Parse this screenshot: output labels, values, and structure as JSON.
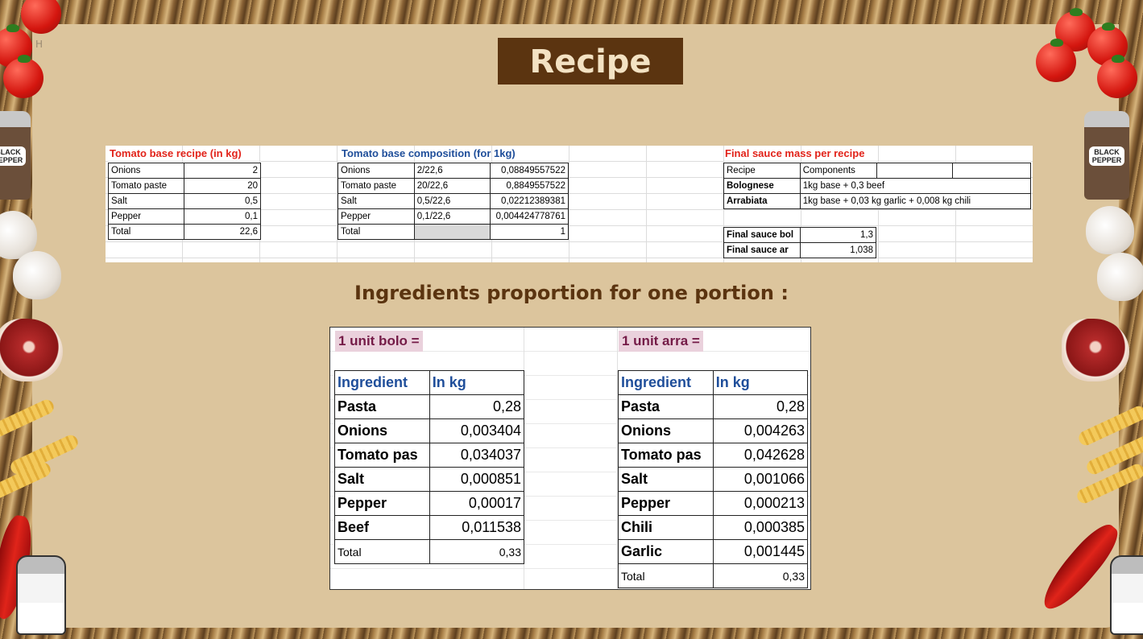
{
  "slide": {
    "corner_mark": "H",
    "title": "Recipe",
    "subtitle": "Ingredients proportion for one portion :"
  },
  "colors": {
    "title_bg": "#5b3410",
    "slide_bg": "#dcc59d",
    "red_header": "#e2231a",
    "blue_header": "#1f4e9a",
    "unit_label_bg": "#ead1dc",
    "unit_label_text": "#741b47"
  },
  "decorations": {
    "black_pepper_label": "BLACK PEPPER",
    "left_pepper_label": "BLACK\nPEPPER"
  },
  "tomato_base": {
    "caption": "Tomato base recipe (in kg)",
    "rows": [
      {
        "name": "Onions",
        "value": "2"
      },
      {
        "name": "Tomato paste",
        "value": "20"
      },
      {
        "name": "Salt",
        "value": "0,5"
      },
      {
        "name": "Pepper",
        "value": "0,1"
      },
      {
        "name": "Total",
        "value": "22,6"
      }
    ]
  },
  "composition": {
    "caption": "Tomato base composition (for 1kg)",
    "rows": [
      {
        "name": "Onions",
        "formula": "2/22,6",
        "value": "0,08849557522"
      },
      {
        "name": "Tomato paste",
        "formula": "20/22,6",
        "value": "0,8849557522"
      },
      {
        "name": "Salt",
        "formula": "0,5/22,6",
        "value": "0,02212389381"
      },
      {
        "name": "Pepper",
        "formula": "0,1/22,6",
        "value": "0,004424778761"
      },
      {
        "name": "Total",
        "formula": "",
        "value": "1"
      }
    ]
  },
  "final_sauce": {
    "caption": "Final sauce mass per recipe",
    "header": {
      "recipe": "Recipe",
      "components": "Components"
    },
    "recipes": [
      {
        "name": "Bolognese",
        "components": "1kg base + 0,3 beef"
      },
      {
        "name": "Arrabiata",
        "components": "1kg base + 0,03 kg garlic + 0,008 kg chili"
      }
    ],
    "totals": [
      {
        "name": "Final sauce bol",
        "value": "1,3"
      },
      {
        "name": "Final sauce ar",
        "value": "1,038"
      }
    ]
  },
  "bolo": {
    "unit_label": "1 unit bolo =",
    "header": {
      "ingredient": "Ingredient",
      "unit": "In kg"
    },
    "rows": [
      {
        "name": "Pasta",
        "value": "0,28"
      },
      {
        "name": "Onions",
        "value": "0,003404"
      },
      {
        "name": "Tomato pas",
        "value": "0,034037"
      },
      {
        "name": "Salt",
        "value": "0,000851"
      },
      {
        "name": "Pepper",
        "value": "0,00017"
      },
      {
        "name": "Beef",
        "value": "0,011538"
      }
    ],
    "total": {
      "name": "Total",
      "value": "0,33"
    }
  },
  "arra": {
    "unit_label": "1 unit arra =",
    "header": {
      "ingredient": "Ingredient",
      "unit": "In kg"
    },
    "rows": [
      {
        "name": "Pasta",
        "value": "0,28"
      },
      {
        "name": "Onions",
        "value": "0,004263"
      },
      {
        "name": "Tomato pas",
        "value": "0,042628"
      },
      {
        "name": "Salt",
        "value": "0,001066"
      },
      {
        "name": "Pepper",
        "value": "0,000213"
      },
      {
        "name": "Chili",
        "value": "0,000385"
      },
      {
        "name": "Garlic",
        "value": "0,001445"
      }
    ],
    "total": {
      "name": "Total",
      "value": "0,33"
    }
  }
}
